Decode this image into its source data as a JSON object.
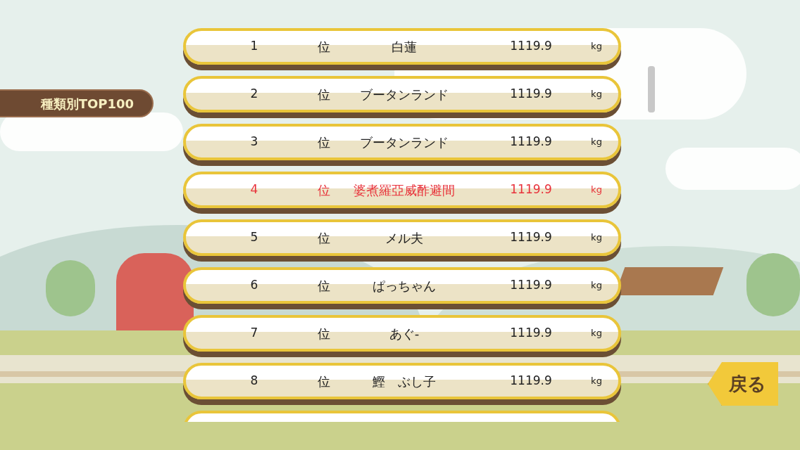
{
  "category_label": "種類別TOP100",
  "rankings": [
    {
      "rank": "1",
      "rank_suffix": "位",
      "name": "白蓮",
      "weight": "1119.9",
      "unit": "kg",
      "highlighted": false
    },
    {
      "rank": "2",
      "rank_suffix": "位",
      "name": "ブータンランド",
      "weight": "1119.9",
      "unit": "kg",
      "highlighted": false
    },
    {
      "rank": "3",
      "rank_suffix": "位",
      "name": "ブータンランド",
      "weight": "1119.9",
      "unit": "kg",
      "highlighted": false
    },
    {
      "rank": "4",
      "rank_suffix": "位",
      "name": "婆煮羅亞威酢避間",
      "weight": "1119.9",
      "unit": "kg",
      "highlighted": true
    },
    {
      "rank": "5",
      "rank_suffix": "位",
      "name": "メル夫",
      "weight": "1119.9",
      "unit": "kg",
      "highlighted": false
    },
    {
      "rank": "6",
      "rank_suffix": "位",
      "name": "ぱっちゃん",
      "weight": "1119.9",
      "unit": "kg",
      "highlighted": false
    },
    {
      "rank": "7",
      "rank_suffix": "位",
      "name": "あぐ-",
      "weight": "1119.9",
      "unit": "kg",
      "highlighted": false
    },
    {
      "rank": "8",
      "rank_suffix": "位",
      "name": "鰹　ぶし子",
      "weight": "1119.9",
      "unit": "kg",
      "highlighted": false
    }
  ],
  "back_button": "戻る"
}
